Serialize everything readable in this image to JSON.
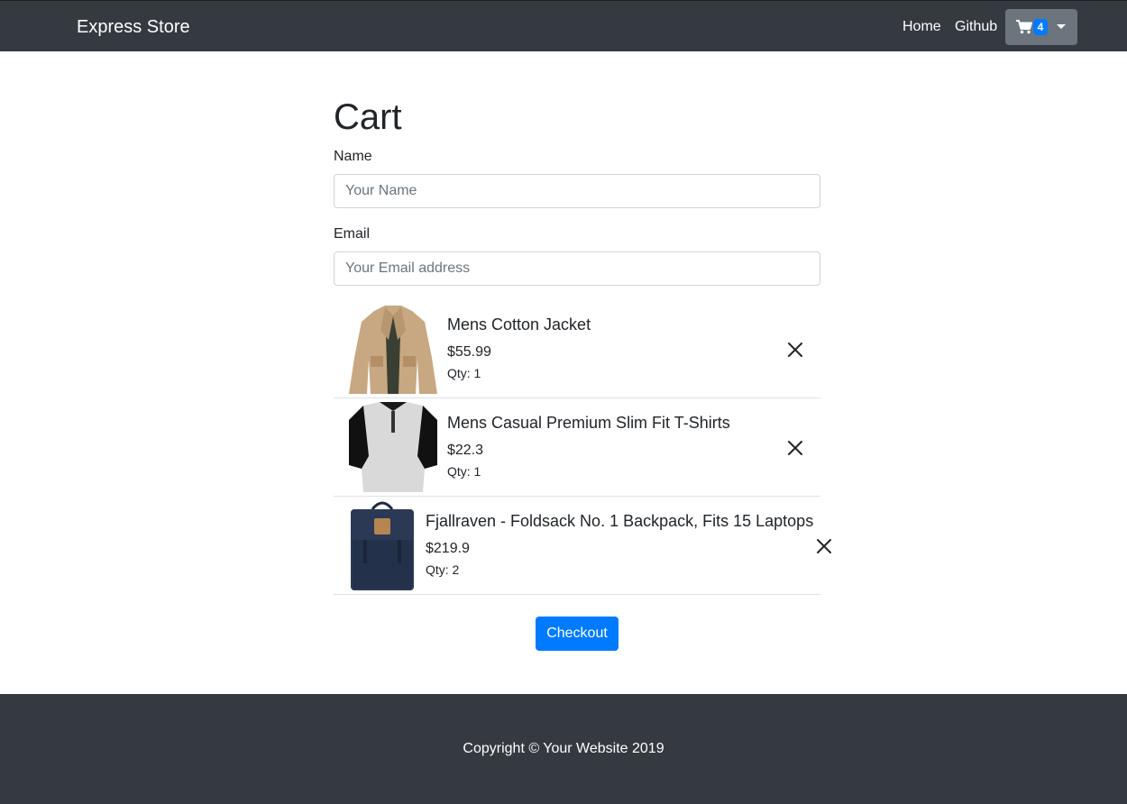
{
  "navbar": {
    "brand": "Express Store",
    "links": [
      {
        "label": "Home"
      },
      {
        "label": "Github"
      }
    ],
    "cart": {
      "icon": "cart-icon",
      "count": "4"
    }
  },
  "page": {
    "title": "Cart"
  },
  "form": {
    "name": {
      "label": "Name",
      "placeholder": "Your Name",
      "value": ""
    },
    "email": {
      "label": "Email",
      "placeholder": "Your Email address",
      "value": ""
    }
  },
  "cart_items": [
    {
      "title": "Mens Cotton Jacket",
      "price": "$55.99",
      "qty": "Qty: 1",
      "image": "jacket-image"
    },
    {
      "title": "Mens Casual Premium Slim Fit T-Shirts",
      "price": "$22.3",
      "qty": "Qty: 1",
      "image": "tshirt-image"
    },
    {
      "title": "Fjallraven - Foldsack No. 1 Backpack, Fits 15 Laptops",
      "price": "$219.9",
      "qty": "Qty: 2",
      "image": "backpack-image"
    }
  ],
  "actions": {
    "checkout_label": "Checkout",
    "remove_icon": "close-icon"
  },
  "footer": {
    "copyright": "Copyright © Your Website 2019"
  },
  "colors": {
    "navbar": "#343a40",
    "primary": "#007bff",
    "secondary": "#6c757d"
  }
}
